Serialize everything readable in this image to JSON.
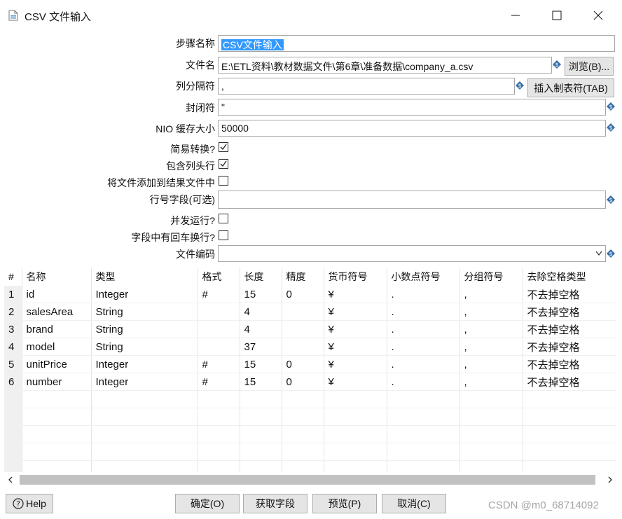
{
  "window": {
    "title": "CSV 文件输入",
    "minimize_icon": "minimize-icon",
    "maximize_icon": "maximize-icon",
    "close_icon": "close-icon"
  },
  "form": {
    "step_name_label": "步骤名称",
    "step_name_value": "CSV文件输入",
    "filename_label": "文件名",
    "filename_value": "E:\\ETL资料\\教材数据文件\\第6章\\准备数据\\company_a.csv",
    "browse_button": "浏览(B)...",
    "delimiter_label": "列分隔符",
    "delimiter_value": ",",
    "insert_tab_button": "插入制表符(TAB)",
    "enclosure_label": "封闭符",
    "enclosure_value": "\"",
    "nio_buffer_label": "NIO 缓存大小",
    "nio_buffer_value": "50000",
    "lazy_conversion_label": "简易转换?",
    "lazy_conversion_checked": true,
    "header_row_label": "包含列头行",
    "header_row_checked": true,
    "add_filename_label": "将文件添加到结果文件中",
    "add_filename_checked": false,
    "row_number_field_label": "行号字段(可选)",
    "row_number_field_value": "",
    "parallel_label": "并发运行?",
    "parallel_checked": false,
    "newline_in_field_label": "字段中有回车换行?",
    "newline_in_field_checked": false,
    "encoding_label": "文件编码",
    "encoding_value": ""
  },
  "table": {
    "headers": [
      "#",
      "名称",
      "类型",
      "格式",
      "长度",
      "精度",
      "货币符号",
      "小数点符号",
      "分组符号",
      "去除空格类型"
    ],
    "rows": [
      [
        "1",
        "id",
        "Integer",
        "#",
        "15",
        "0",
        "¥",
        ".",
        ",",
        "不去掉空格"
      ],
      [
        "2",
        "salesArea",
        "String",
        "",
        "4",
        "",
        "¥",
        ".",
        ",",
        "不去掉空格"
      ],
      [
        "3",
        "brand",
        "String",
        "",
        "4",
        "",
        "¥",
        ".",
        ",",
        "不去掉空格"
      ],
      [
        "4",
        "model",
        "String",
        "",
        "37",
        "",
        "¥",
        ".",
        ",",
        "不去掉空格"
      ],
      [
        "5",
        "unitPrice",
        "Integer",
        "#",
        "15",
        "0",
        "¥",
        ".",
        ",",
        "不去掉空格"
      ],
      [
        "6",
        "number",
        "Integer",
        "#",
        "15",
        "0",
        "¥",
        ".",
        ",",
        "不去掉空格"
      ]
    ],
    "empty_rows": 5
  },
  "footer": {
    "help_button": "Help",
    "ok_button": "确定(O)",
    "get_fields_button": "获取字段",
    "preview_button": "预览(P)",
    "cancel_button": "取消(C)",
    "watermark": "CSDN @m0_68714092"
  },
  "colors": {
    "selection": "#3399ff",
    "button_bg": "#e5e5e5",
    "variable_icon": "#3a6fa8"
  }
}
